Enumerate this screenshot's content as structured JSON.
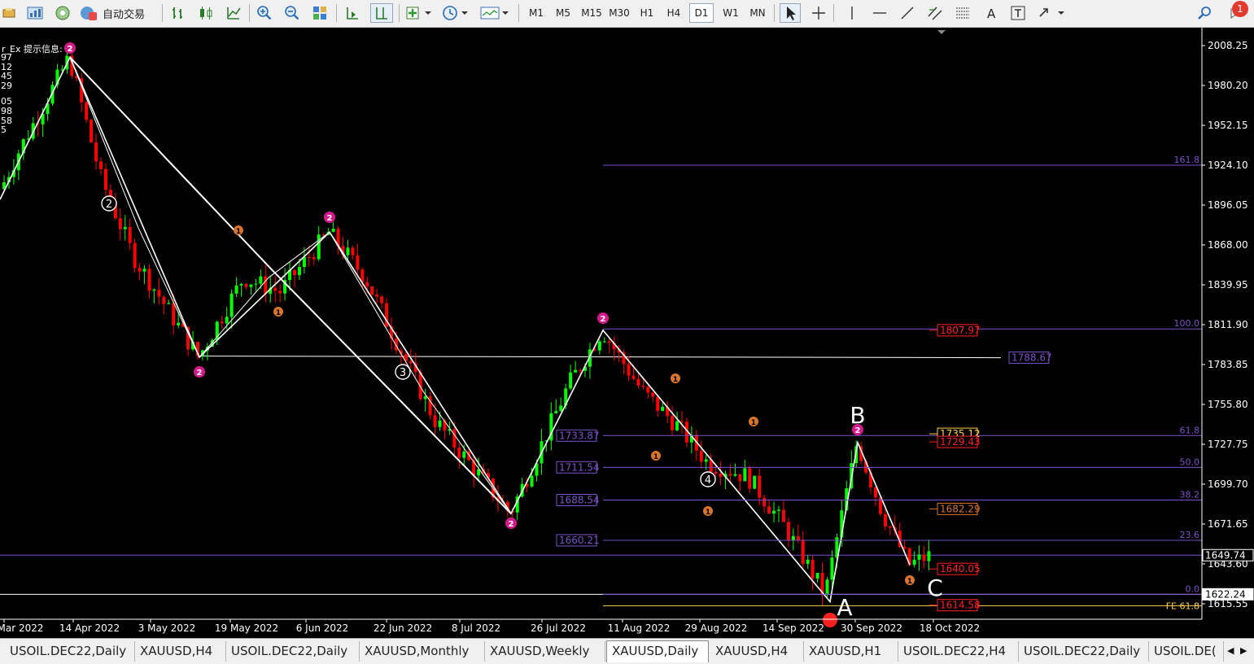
{
  "toolbar": {
    "autotrade_label": "自动交易",
    "timeframes": [
      "M1",
      "M5",
      "M15",
      "M30",
      "H1",
      "H4",
      "D1",
      "W1",
      "MN"
    ],
    "active_timeframe": "D1",
    "notification_count": "1"
  },
  "chart": {
    "indicator_title": "r_Ex 提示信息:",
    "left_values": [
      "97",
      "12",
      "45",
      "29",
      "05",
      "98",
      "58",
      "5"
    ],
    "price_axis": [
      "2008.25",
      "1980.20",
      "1952.15",
      "1924.10",
      "1896.05",
      "1868.00",
      "1839.95",
      "1811.90",
      "1783.85",
      "1755.80",
      "1727.75",
      "1699.70",
      "1671.65",
      "1643.60",
      "1615.55"
    ],
    "current_price": "1649.74",
    "marked_price": "1622.24",
    "date_axis": [
      "Mar 2022",
      "14 Apr 2022",
      "3 May 2022",
      "19 May 2022",
      "6 Jun 2022",
      "22 Jun 2022",
      "8 Jul 2022",
      "26 Jul 2022",
      "11 Aug 2022",
      "29 Aug 2022",
      "14 Sep 2022",
      "30 Sep 2022",
      "18 Oct 2022"
    ],
    "fib_left_labels": [
      "1733.87",
      "1711.54",
      "1688.54",
      "1660.21"
    ],
    "fib_right_labels": [
      "161.8",
      "100.0",
      "61.8",
      "50.0",
      "38.2",
      "23.6",
      "0.0",
      "FE 61.8"
    ],
    "orange_price_labels": [
      "1807.97",
      "1735.12",
      "1729.43",
      "1682.29",
      "1640.05",
      "1614.58"
    ],
    "hline_label": "1788.67",
    "wave_labels": [
      "A",
      "B",
      "C"
    ],
    "wave_circle_labels": [
      "2",
      "3",
      "4"
    ],
    "small_marker_labels": [
      "1",
      "2"
    ],
    "colors": {
      "bull": "#00ff00",
      "bear": "#ff0000",
      "fib": "#7b52c8",
      "grid_line": "#ffffff",
      "marker_pink": "#d6198a",
      "marker_orange": "#d9742b",
      "label_red": "#ff2020",
      "label_yellow": "#ffd24a"
    }
  },
  "tabs": [
    {
      "label": "USOIL.DEC22,Daily",
      "active": false
    },
    {
      "label": "XAUUSD,H4",
      "active": false
    },
    {
      "label": "USOIL.DEC22,Daily",
      "active": false
    },
    {
      "label": "XAUUSD,Monthly",
      "active": false
    },
    {
      "label": "XAUUSD,Weekly",
      "active": false
    },
    {
      "label": "XAUUSD,Daily",
      "active": true
    },
    {
      "label": "XAUUSD,H4",
      "active": false
    },
    {
      "label": "XAUUSD,H1",
      "active": false
    },
    {
      "label": "USOIL.DEC22,H4",
      "active": false
    },
    {
      "label": "USOIL.DEC22,Daily",
      "active": false
    },
    {
      "label": "USOIL.DE(",
      "active": false
    }
  ]
}
